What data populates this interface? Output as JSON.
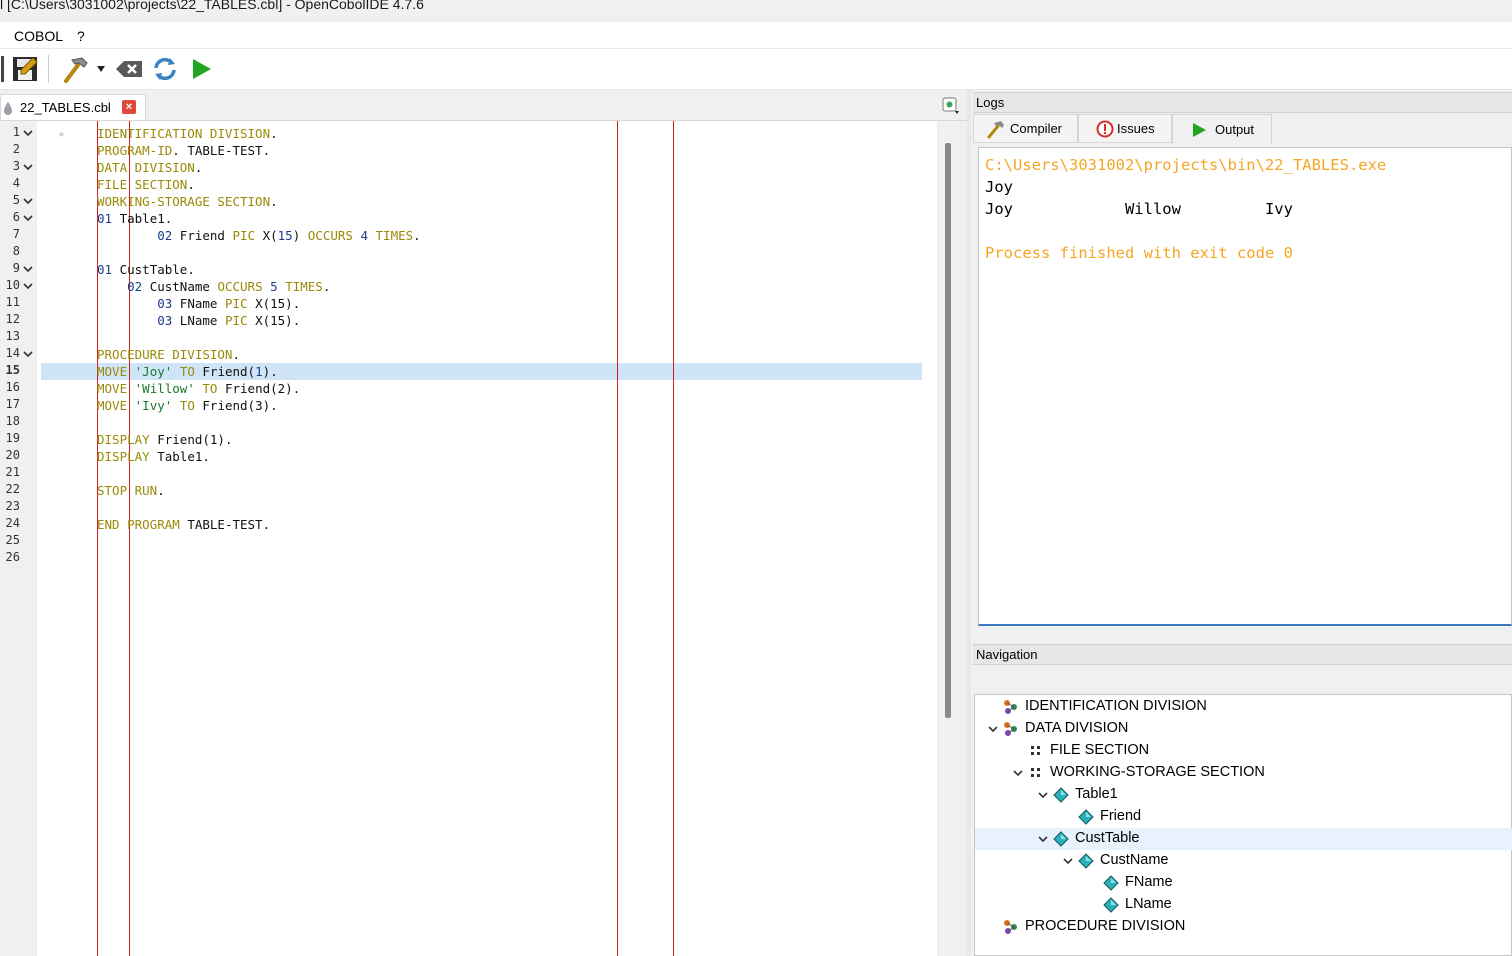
{
  "window": {
    "title": "l [C:\\Users\\3031002\\projects\\22_TABLES.cbl] - OpenCobolIDE 4.7.6"
  },
  "menu": {
    "items": [
      "COBOL",
      "?"
    ]
  },
  "editor": {
    "tab_label": "22_TABLES.cbl",
    "fold_marker_lines": [
      1,
      3,
      5,
      6,
      9,
      10,
      14
    ],
    "current_line": 15,
    "lines": [
      [
        [
          "IDENTIFICATION DIVISION",
          "kw"
        ],
        [
          ".",
          ""
        ]
      ],
      [
        [
          "PROGRAM-ID",
          "kw"
        ],
        [
          ". TABLE-TEST.",
          ""
        ]
      ],
      [
        [
          "DATA DIVISION",
          "kw"
        ],
        [
          ".",
          ""
        ]
      ],
      [
        [
          "FILE SECTION",
          "kw"
        ],
        [
          ".",
          ""
        ]
      ],
      [
        [
          "WORKING-STORAGE SECTION",
          "kw"
        ],
        [
          ".",
          ""
        ]
      ],
      [
        [
          "01",
          "num"
        ],
        [
          " Table1.",
          ""
        ]
      ],
      [
        [
          "        ",
          ""
        ],
        [
          "02",
          "num"
        ],
        [
          " Friend ",
          ""
        ],
        [
          "PIC",
          "kw"
        ],
        [
          " X(",
          ""
        ],
        [
          "15",
          "num"
        ],
        [
          ") ",
          ""
        ],
        [
          "OCCURS",
          "kw"
        ],
        [
          " ",
          ""
        ],
        [
          "4",
          "num"
        ],
        [
          " ",
          ""
        ],
        [
          "TIMES",
          "kw"
        ],
        [
          ".",
          ""
        ]
      ],
      [],
      [
        [
          "01",
          "num"
        ],
        [
          " CustTable.",
          ""
        ]
      ],
      [
        [
          "    ",
          ""
        ],
        [
          "02",
          "num"
        ],
        [
          " CustName ",
          ""
        ],
        [
          "OCCURS",
          "kw"
        ],
        [
          " ",
          ""
        ],
        [
          "5",
          "num"
        ],
        [
          " ",
          ""
        ],
        [
          "TIMES",
          "kw"
        ],
        [
          ".",
          ""
        ]
      ],
      [
        [
          "        ",
          ""
        ],
        [
          "03",
          "num"
        ],
        [
          " FName ",
          ""
        ],
        [
          "PIC",
          "kw"
        ],
        [
          " X(15).",
          ""
        ]
      ],
      [
        [
          "        ",
          ""
        ],
        [
          "03",
          "num"
        ],
        [
          " LName ",
          ""
        ],
        [
          "PIC",
          "kw"
        ],
        [
          " X(15).",
          ""
        ]
      ],
      [],
      [
        [
          "PROCEDURE DIVISION",
          "kw"
        ],
        [
          ".",
          ""
        ]
      ],
      [
        [
          "MOVE",
          "kw"
        ],
        [
          " ",
          ""
        ],
        [
          "'Joy'",
          "str"
        ],
        [
          " ",
          ""
        ],
        [
          "TO",
          "kw"
        ],
        [
          " Friend(",
          ""
        ],
        [
          "1",
          "num"
        ],
        [
          ").",
          ""
        ]
      ],
      [
        [
          "MOVE",
          "kw"
        ],
        [
          " ",
          ""
        ],
        [
          "'Willow'",
          "str"
        ],
        [
          " ",
          ""
        ],
        [
          "TO",
          "kw"
        ],
        [
          " Friend(2).",
          ""
        ]
      ],
      [
        [
          "MOVE",
          "kw"
        ],
        [
          " ",
          ""
        ],
        [
          "'Ivy'",
          "str"
        ],
        [
          " ",
          ""
        ],
        [
          "TO",
          "kw"
        ],
        [
          " Friend(3).",
          ""
        ]
      ],
      [],
      [
        [
          "DISPLAY",
          "kw"
        ],
        [
          " Friend(1).",
          ""
        ]
      ],
      [
        [
          "DISPLAY",
          "kw"
        ],
        [
          " Table1.",
          ""
        ]
      ],
      [],
      [
        [
          "STOP RUN",
          "kw"
        ],
        [
          ".",
          ""
        ]
      ],
      [],
      [
        [
          "END PROGRAM",
          "kw"
        ],
        [
          " TABLE-TEST.",
          ""
        ]
      ],
      [],
      []
    ]
  },
  "logs": {
    "header": "Logs",
    "tabs": [
      "Compiler",
      "Issues",
      "Output"
    ],
    "active_tab": "Output",
    "output_lines": [
      {
        "text": "C:\\Users\\3031002\\projects\\bin\\22_TABLES.exe",
        "color": "orange"
      },
      {
        "text": "Joy",
        "color": ""
      },
      {
        "text": "Joy            Willow         Ivy",
        "color": ""
      },
      {
        "text": "",
        "color": ""
      },
      {
        "text": "Process finished with exit code 0",
        "color": "orange"
      }
    ]
  },
  "navigation": {
    "header": "Navigation",
    "tree": [
      {
        "label": "IDENTIFICATION DIVISION",
        "depth": 0,
        "expandable": false,
        "icon": "division-icon"
      },
      {
        "label": "DATA DIVISION",
        "depth": 0,
        "expandable": true,
        "icon": "division-icon"
      },
      {
        "label": "FILE SECTION",
        "depth": 1,
        "expandable": false,
        "icon": "section-icon"
      },
      {
        "label": "WORKING-STORAGE SECTION",
        "depth": 1,
        "expandable": true,
        "icon": "section-icon"
      },
      {
        "label": "Table1",
        "depth": 2,
        "expandable": true,
        "icon": "variable-icon"
      },
      {
        "label": "Friend",
        "depth": 3,
        "expandable": false,
        "icon": "variable-icon"
      },
      {
        "label": "CustTable",
        "depth": 2,
        "expandable": true,
        "icon": "variable-icon",
        "selected": true
      },
      {
        "label": "CustName",
        "depth": 3,
        "expandable": true,
        "icon": "variable-icon"
      },
      {
        "label": "FName",
        "depth": 4,
        "expandable": false,
        "icon": "variable-icon"
      },
      {
        "label": "LName",
        "depth": 4,
        "expandable": false,
        "icon": "variable-icon"
      },
      {
        "label": "PROCEDURE DIVISION",
        "depth": 0,
        "expandable": false,
        "icon": "division-icon"
      }
    ]
  }
}
